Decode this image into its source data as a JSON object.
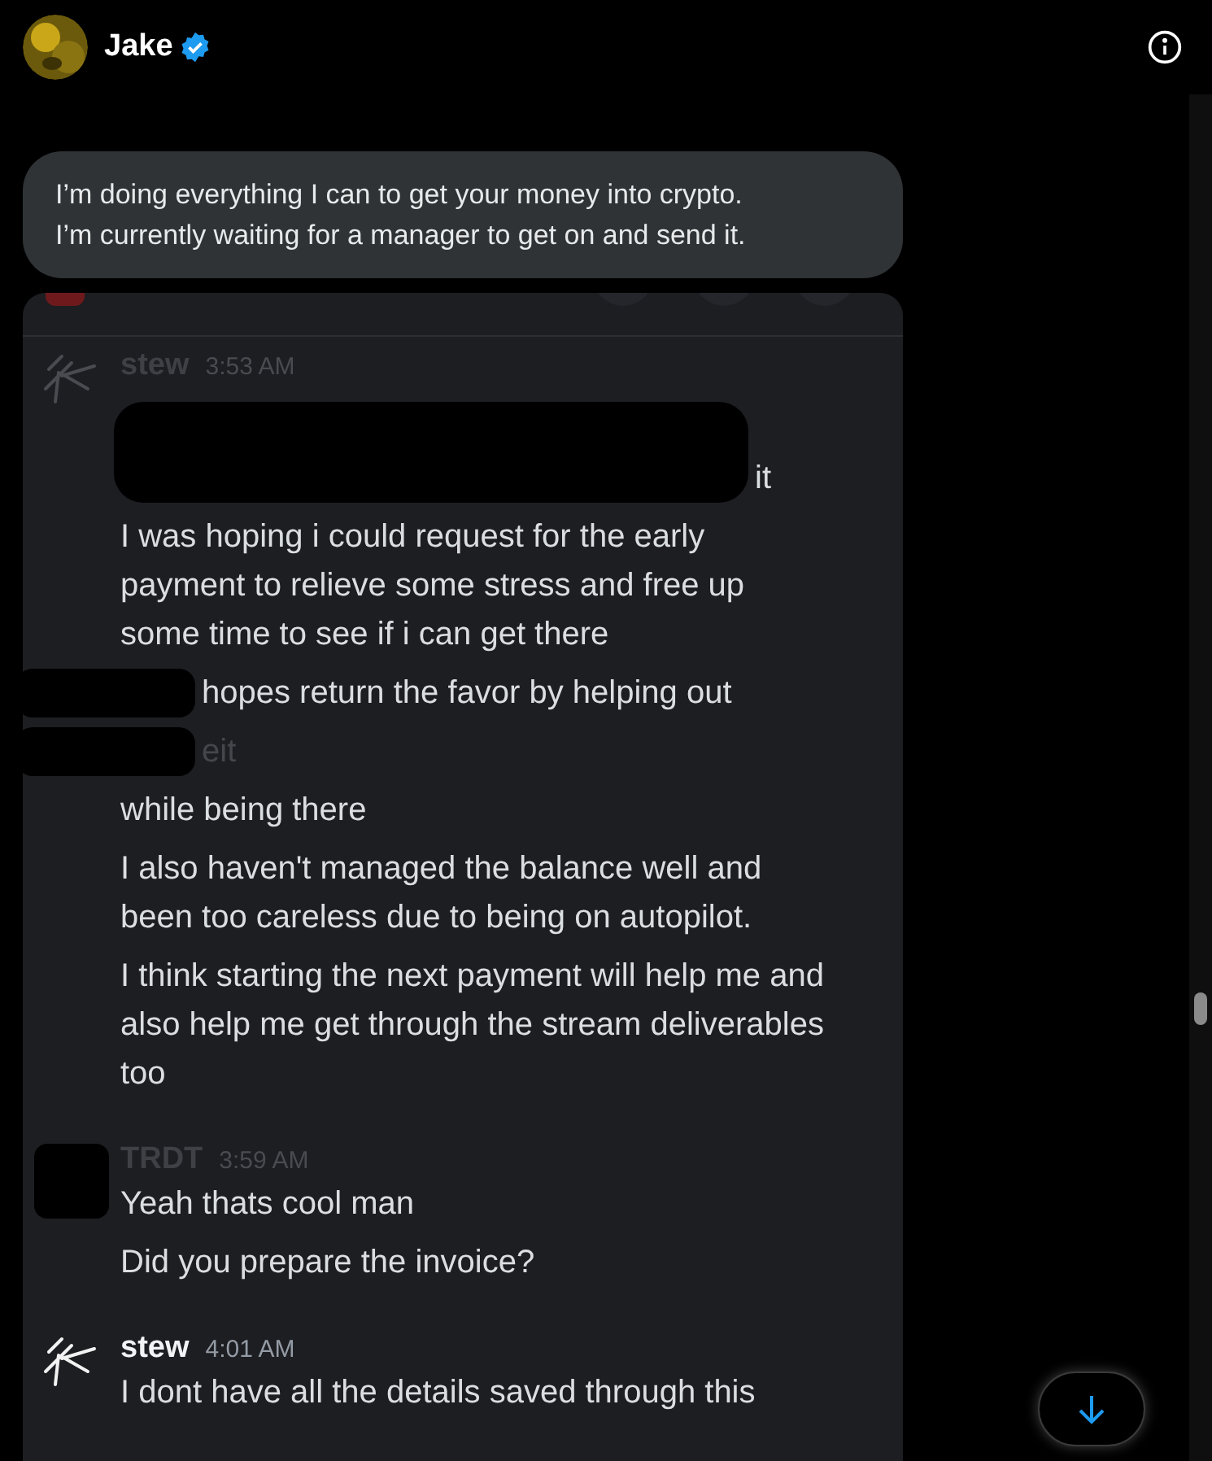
{
  "header": {
    "name": "Jake",
    "verified": true
  },
  "incoming_message": {
    "lines": [
      "I’m doing everything I can to get your money into crypto.",
      "I’m currently waiting for a manager to get on and send it."
    ]
  },
  "embedded_screenshot": {
    "messages": [
      {
        "author": "stew",
        "time": "3:53 AM",
        "faded": true,
        "kind": "signature",
        "paragraphs": [
          {
            "kind": "mostly_hidden",
            "text": "it",
            "faded": false
          },
          {
            "kind": "full",
            "text": "I was hoping i could request for the early payment to relieve some stress and free up some time to see if i can get there",
            "faded": false
          },
          {
            "kind": "partly_hidden",
            "text": "hopes return the favor by helping out",
            "faded": false
          },
          {
            "kind": "partly_hidden",
            "text": "eit",
            "faded": true
          },
          {
            "kind": "full",
            "text": "while being there",
            "faded": false
          },
          {
            "kind": "full",
            "text": "I also haven't managed the balance well and been too careless due to being on autopilot.",
            "faded": false
          },
          {
            "kind": "full",
            "text": "I think starting the next payment will help me and also help me get through the stream deliverables too",
            "faded": false
          }
        ]
      },
      {
        "author": "TRDT",
        "time": "3:59 AM",
        "faded": true,
        "kind": "redacted",
        "paragraphs": [
          {
            "kind": "full",
            "text": "Yeah thats cool man",
            "faded": false
          },
          {
            "kind": "full",
            "text": "Did you prepare the invoice?",
            "faded": false
          }
        ]
      },
      {
        "author": "stew",
        "time": "4:01 AM",
        "faded": false,
        "kind": "signature",
        "paragraphs": [
          {
            "kind": "full",
            "text": "I dont have all the details saved through this",
            "faded": false
          }
        ]
      }
    ]
  }
}
